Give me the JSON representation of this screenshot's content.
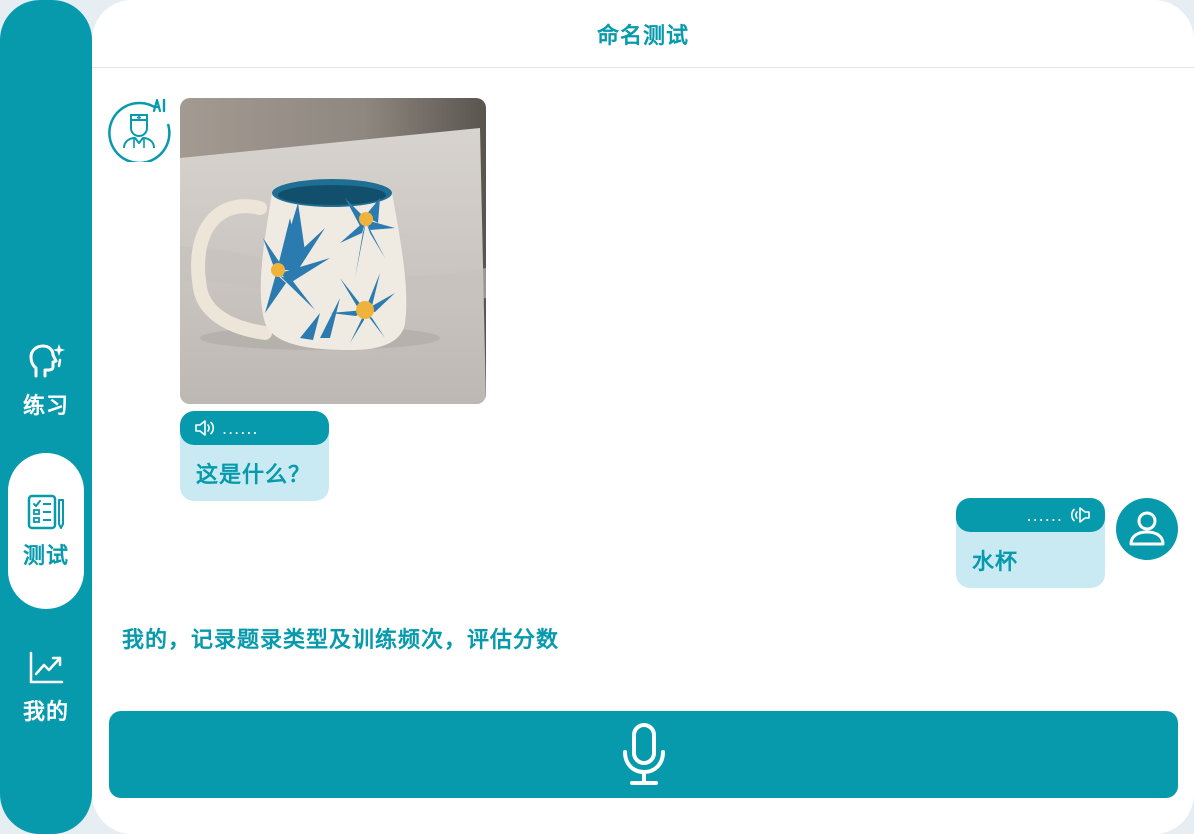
{
  "header": {
    "title": "命名测试"
  },
  "sidebar": {
    "items": [
      {
        "label": "练习",
        "icon": "head-sparkle-icon",
        "active": false
      },
      {
        "label": "测试",
        "icon": "checklist-icon",
        "active": true
      },
      {
        "label": "我的",
        "icon": "trend-chart-icon",
        "active": false
      }
    ]
  },
  "chat": {
    "ai": {
      "avatar": "ai-doctor-avatar",
      "image": "blue-flower-mug-photo",
      "audio_dots": "......",
      "text": "这是什么？"
    },
    "user": {
      "avatar": "user-avatar",
      "audio_dots": "......",
      "text": "水杯"
    }
  },
  "note": "我的，记录题录类型及训练频次，评估分数",
  "mic": {
    "icon": "microphone-icon"
  },
  "colors": {
    "accent": "#079aad",
    "bubble": "#c9eaf3",
    "background": "#ffffff"
  }
}
